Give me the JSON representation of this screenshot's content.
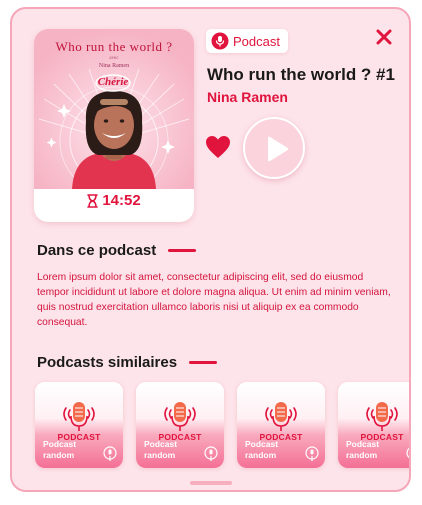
{
  "colors": {
    "accent": "#e0143d",
    "panel_bg": "#fde4ea",
    "panel_border": "#f5a6b8"
  },
  "cover": {
    "title": "Who run the world ?",
    "avec": "avec",
    "host": "Nina Ramen",
    "logo": "Chérie",
    "duration": "14:52"
  },
  "badge": {
    "icon": "podcast-icon",
    "label": "Podcast"
  },
  "episode": {
    "title": "Who run the world ? #1",
    "host": "Nina Ramen",
    "liked": true
  },
  "about": {
    "heading": "Dans ce podcast",
    "description": "Lorem ipsum dolor sit amet, consectetur adipiscing elit, sed do eiusmod tempor incididunt ut labore et dolore magna aliqua. Ut enim ad minim veniam, quis nostrud exercitation ullamco laboris nisi ut aliquip ex ea commodo consequat."
  },
  "similar": {
    "heading": "Podcasts similaires",
    "items": [
      {
        "art_text": "PODCAST",
        "label": "Podcast random"
      },
      {
        "art_text": "PODCAST",
        "label": "Podcast random"
      },
      {
        "art_text": "PODCAST",
        "label": "Podcast random"
      },
      {
        "art_text": "PODCAST",
        "label": "Podcast random"
      }
    ]
  }
}
